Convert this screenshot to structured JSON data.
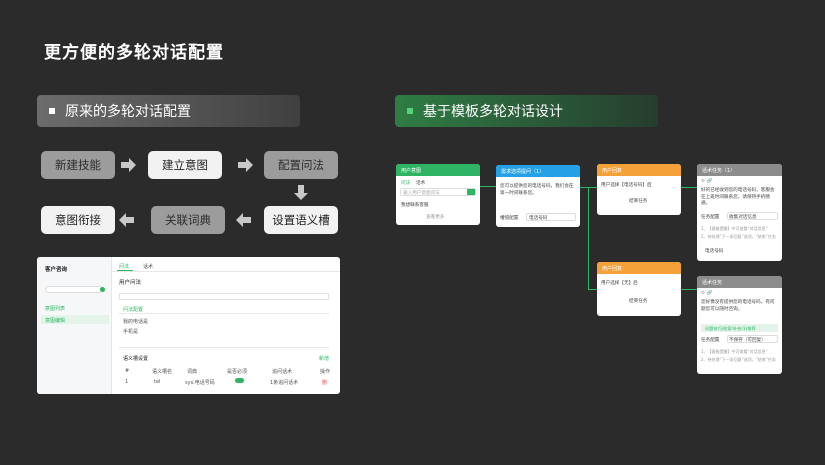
{
  "title": "更方便的多轮对话配置",
  "left_section": {
    "header": "原来的多轮对话配置",
    "steps": [
      "新建技能",
      "建立意图",
      "配置问法",
      "设置语义槽",
      "关联词典",
      "意图衔接"
    ]
  },
  "right_section": {
    "header": "基于模板多轮对话设计"
  },
  "screenshot": {
    "app_title": "客户咨询",
    "tabs": [
      "问法",
      "话术"
    ],
    "panel_title": "用户问法",
    "sidebar_items": [
      "意图列表",
      "意图编辑"
    ],
    "fields": [
      "问法配置",
      "我的电话是",
      "手机是"
    ],
    "table_title": "语义槽设置",
    "table_headers": [
      "#",
      "语义槽名",
      "词典",
      "是否必须",
      "追问话术",
      "操作"
    ],
    "table_row": [
      "1",
      "tel",
      "sys.电话号码",
      "",
      "1条追问话术",
      "删"
    ],
    "add_label": "新增"
  },
  "nodes": {
    "n1": {
      "title": "用户意图",
      "tabs": [
        "问法",
        "话术"
      ],
      "placeholder": "输入用户意图问法",
      "item": "我想联系客服",
      "footer": "查看更多"
    },
    "n2": {
      "title": "需求选项提问（1）",
      "body": "您可以提供您的电话号码，我们会在第一时间联系您。",
      "row_label": "槽值配置",
      "row_value": "电话号码"
    },
    "n3": {
      "title": "用户回复",
      "body": "用户选择【电话号码】后",
      "action": "结束任务"
    },
    "n4": {
      "title": "用户回复",
      "body": "用户选择【无】后",
      "action": "结束任务"
    },
    "n5": {
      "title": "话术任务（1）",
      "body": "好的已经收到您的电话号码，客服会在上班时间联系您，请保持手机畅通。",
      "row_label": "任务配置",
      "row_value": "收集对话信息",
      "notes": [
        "1、【客服提醒】中可查看“对话信息”",
        "2、待处理“下一条回复”选项，“结束”任务"
      ],
      "tag": "电话号码"
    },
    "n6": {
      "title": "话术任务",
      "body": "您好像没有提供您的电话号码，有问题您可以随时咨询。",
      "badge": "问题技巧/检索/补充(1)推荐",
      "row_label": "任务配置",
      "row_value": "不保存（可回复）",
      "notes": [
        "1、【客服提醒】中可查看“对话信息”",
        "2、待处理“下一条回复”选项，“结束”任务"
      ]
    }
  }
}
